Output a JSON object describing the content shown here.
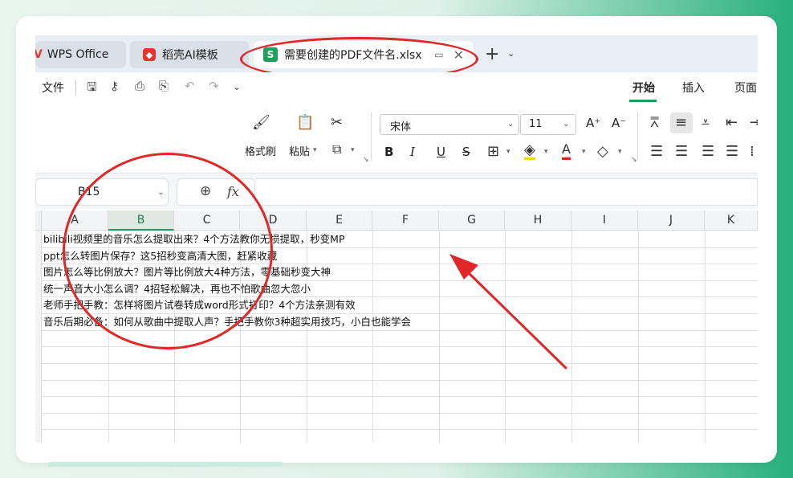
{
  "tabs": {
    "wps": "WPS Office",
    "ai_template": "稻壳AI模板",
    "file": "需要创建的PDF文件名.xlsx",
    "file_icon_letter": "S",
    "plus": "+",
    "more": "⌄"
  },
  "menu": {
    "file": "文件",
    "tabs": [
      "开始",
      "插入",
      "页面"
    ]
  },
  "ribbon": {
    "format_painter": "格式刷",
    "paste": "粘贴",
    "font_name": "宋体",
    "font_size": "11",
    "bold": "B",
    "italic": "I",
    "underline": "U",
    "strike": "S"
  },
  "formula_bar": {
    "cell_ref": "B15",
    "fx": "fx"
  },
  "grid": {
    "columns": [
      "A",
      "B",
      "C",
      "D",
      "E",
      "F",
      "G",
      "H",
      "I",
      "J",
      "K"
    ],
    "selected_column": "B",
    "rows": [
      "bilibili视频里的音乐怎么提取出来？4个方法教你无损提取，秒变MP",
      "ppt怎么转图片保存？这5招秒变高清大图，赶紧收藏",
      "图片怎么等比例放大？图片等比例放大4种方法，零基础秒变大神",
      "统一声音大小怎么调？4招轻松解决，再也不怕歌曲忽大忽小",
      "老师手把手教：怎样将图片试卷转成word形式打印？4个方法亲测有效",
      "音乐后期必备：如何从歌曲中提取人声？手把手教你3种超实用技巧，小白也能学会"
    ]
  },
  "colors": {
    "accent_green": "#1e9b5b",
    "annotation_red": "#e12727"
  }
}
